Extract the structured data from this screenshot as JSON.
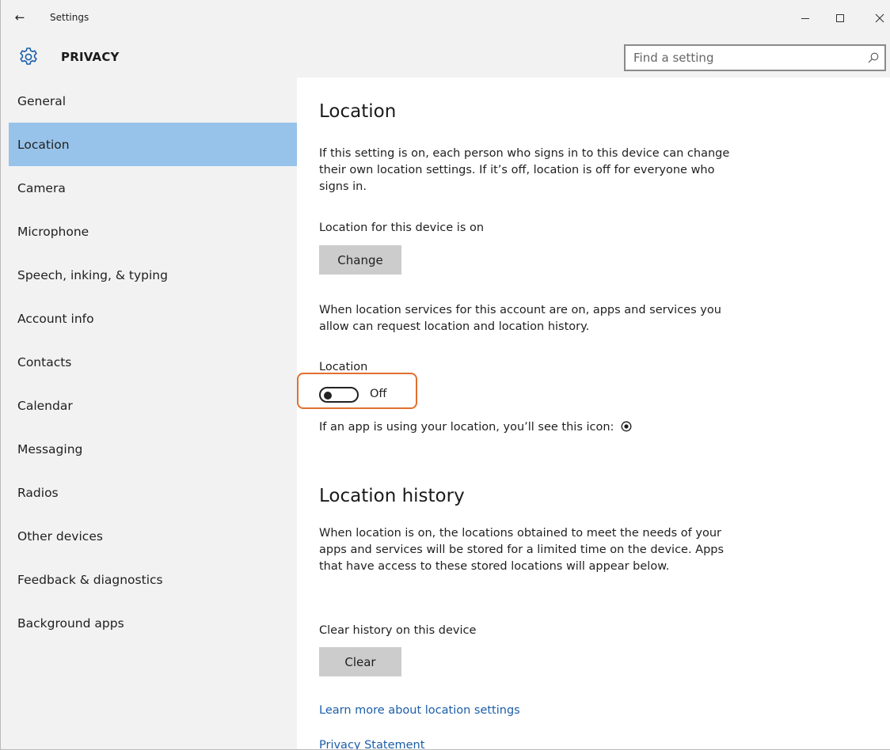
{
  "window": {
    "app_title": "Settings",
    "back_icon": "back-arrow-icon",
    "controls": {
      "minimize": "minimize-icon",
      "maximize": "maximize-icon",
      "close": "close-icon"
    }
  },
  "header": {
    "icon": "gear-icon",
    "title": "PRIVACY",
    "search": {
      "placeholder": "Find a setting",
      "value": ""
    }
  },
  "sidebar": {
    "items": [
      {
        "label": "General",
        "selected": false
      },
      {
        "label": "Location",
        "selected": true
      },
      {
        "label": "Camera",
        "selected": false
      },
      {
        "label": "Microphone",
        "selected": false
      },
      {
        "label": "Speech, inking, & typing",
        "selected": false
      },
      {
        "label": "Account info",
        "selected": false
      },
      {
        "label": "Contacts",
        "selected": false
      },
      {
        "label": "Calendar",
        "selected": false
      },
      {
        "label": "Messaging",
        "selected": false
      },
      {
        "label": "Radios",
        "selected": false
      },
      {
        "label": "Other devices",
        "selected": false
      },
      {
        "label": "Feedback & diagnostics",
        "selected": false
      },
      {
        "label": "Background apps",
        "selected": false
      }
    ],
    "selected_color": "#97c3ea"
  },
  "content": {
    "location": {
      "heading": "Location",
      "description": "If this setting is on, each person who signs in to this device can change their own location settings. If it’s off, location is off for everyone who signs in.",
      "device_status": "Location for this device is on",
      "change_button": "Change",
      "account_description": "When location services for this account are on, apps and services you allow can request location and location history.",
      "toggle_label": "Location",
      "toggle_state": "Off",
      "toggle_on": false,
      "icon_note": "If an app is using your location, you’ll see this icon:",
      "highlight_color": "#e07030"
    },
    "history": {
      "heading": "Location history",
      "description": "When location is on, the locations obtained to meet the needs of your apps and services will be stored for a limited time on the device. Apps that have access to these stored locations will appear below.",
      "clear_label": "Clear history on this device",
      "clear_button": "Clear"
    },
    "links": {
      "learn_more": "Learn more about location settings",
      "privacy": "Privacy Statement"
    }
  }
}
